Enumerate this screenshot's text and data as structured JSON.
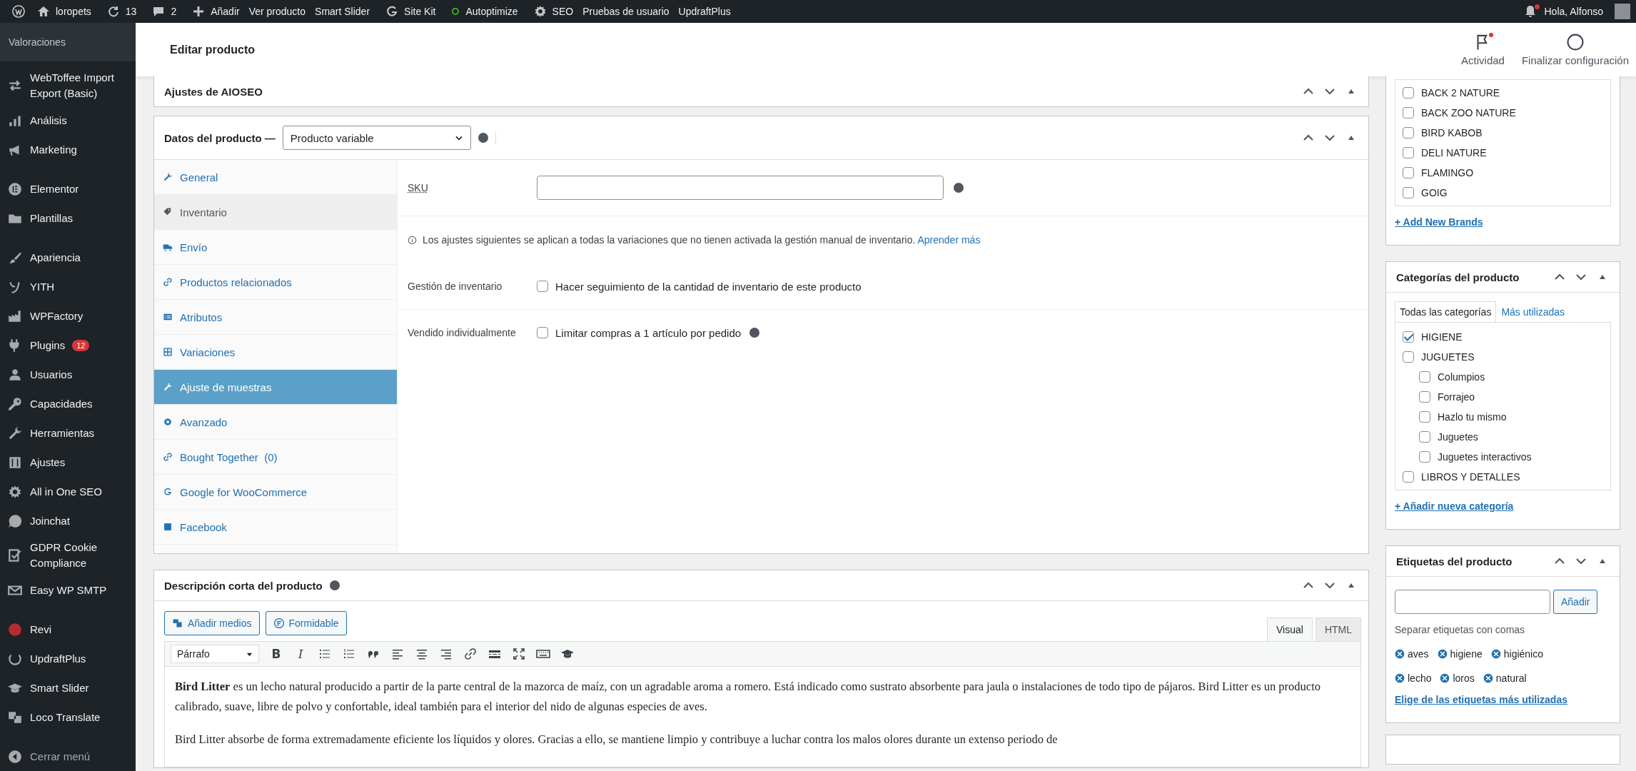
{
  "admin_bar": {
    "site": "loropets",
    "updates": "13",
    "comments": "2",
    "items": [
      "Añadir",
      "Ver producto",
      "Smart Slider",
      "Site Kit",
      "Autoptimize",
      "SEO",
      "Pruebas de usuario",
      "UpdraftPlus"
    ],
    "greeting": "Hola, Alfonso"
  },
  "sidebar": {
    "submenu_item": "Valoraciones",
    "groups": [
      [
        {
          "label": "WebToffee Import Export (Basic)"
        },
        {
          "label": "Análisis"
        },
        {
          "label": "Marketing"
        }
      ],
      [
        {
          "label": "Elementor"
        },
        {
          "label": "Plantillas"
        }
      ],
      [
        {
          "label": "Apariencia"
        },
        {
          "label": "YITH"
        },
        {
          "label": "WPFactory"
        },
        {
          "label": "Plugins",
          "badge": "12"
        },
        {
          "label": "Usuarios"
        },
        {
          "label": "Capacidades"
        },
        {
          "label": "Herramientas"
        },
        {
          "label": "Ajustes"
        },
        {
          "label": "All in One SEO"
        },
        {
          "label": "Joinchat"
        },
        {
          "label": "GDPR Cookie Compliance"
        },
        {
          "label": "Easy WP SMTP"
        }
      ],
      [
        {
          "label": "Revi"
        },
        {
          "label": "UpdraftPlus"
        },
        {
          "label": "Smart Slider"
        },
        {
          "label": "Loco Translate"
        }
      ]
    ],
    "collapse": "Cerrar menú"
  },
  "header": {
    "title": "Editar producto",
    "actions": [
      "Actividad",
      "Finalizar configuración"
    ]
  },
  "aioseo": {
    "title": "Ajustes de AIOSEO"
  },
  "product_data": {
    "title": "Datos del producto —",
    "type": "Producto variable",
    "tabs": [
      {
        "label": "General",
        "selected": false,
        "hovered": false
      },
      {
        "label": "Inventario",
        "selected": true,
        "hovered": false
      },
      {
        "label": "Envío",
        "selected": false,
        "hovered": false
      },
      {
        "label": "Productos relacionados",
        "selected": false,
        "hovered": false
      },
      {
        "label": "Atributos",
        "selected": false,
        "hovered": false
      },
      {
        "label": "Variaciones",
        "selected": false,
        "hovered": false
      },
      {
        "label": "Ajuste de muestras",
        "selected": false,
        "hovered": true
      },
      {
        "label": "Avanzado",
        "selected": false,
        "hovered": false
      },
      {
        "label": "Bought Together  (0)",
        "selected": false,
        "hovered": false
      },
      {
        "label": "Google for WooCommerce",
        "selected": false,
        "hovered": false
      },
      {
        "label": "Facebook",
        "selected": false,
        "hovered": false
      }
    ],
    "sku": {
      "label": "SKU"
    },
    "notice": {
      "text": "Los ajustes siguientes se aplican a todas la variaciones que no tienen activada la gestión manual de inventario.",
      "link": "Aprender más"
    },
    "options": [
      {
        "label": "Gestión de inventario",
        "text": "Hacer seguimiento de la cantidad de inventario de este producto",
        "checked": false,
        "help": false
      },
      {
        "label": "Vendido individualmente",
        "text": "Limitar compras a 1 artículo por pedido",
        "checked": false,
        "help": true
      }
    ]
  },
  "short_description": {
    "title": "Descripción corta del producto",
    "buttons": [
      "Añadir medios",
      "Formidable"
    ],
    "tabs": [
      {
        "label": "Visual",
        "selected": true
      },
      {
        "label": "HTML",
        "selected": false
      }
    ],
    "format": "Párrafo",
    "text_tools": [
      {
        "kind": "bold",
        "label": "B"
      },
      {
        "kind": "italic",
        "label": "I"
      }
    ],
    "paragraphs": [
      "**Bird Litter** es un lecho natural producido a partir de la parte central de la mazorca de maíz, con un agradable aroma a romero. Está indicado como sustrato absorbente para jaula o instalaciones de todo tipo de pájaros. Bird Litter es un producto calibrado, suave, libre de polvo y confortable, ideal también para el interior del nido de algunas especies de aves.",
      "Bird Litter absorbe de forma extremadamente eficiente los líquidos y olores. Gracias a ello, se mantiene limpio y contribuye a luchar contra los malos olores durante un extenso periodo de"
    ]
  },
  "brands": {
    "items": [
      {
        "label": "BACK 2 NATURE",
        "checked": false
      },
      {
        "label": "BACK ZOO NATURE",
        "checked": false
      },
      {
        "label": "BIRD KABOB",
        "checked": false
      },
      {
        "label": "DELI NATURE",
        "checked": false
      },
      {
        "label": "FLAMINGO",
        "checked": false
      },
      {
        "label": "GOIG",
        "checked": false
      }
    ],
    "link": "+ Add New Brands"
  },
  "categories": {
    "title": "Categorías del producto",
    "tabs": [
      {
        "label": "Todas las categorías",
        "selected": true
      },
      {
        "label": "Más utilizadas",
        "selected": false
      }
    ],
    "items": [
      {
        "label": "HIGIENE",
        "checked": true
      },
      {
        "label": "JUGUETES",
        "checked": false,
        "children": [
          {
            "label": "Columpios",
            "checked": false
          },
          {
            "label": "Forrajeo",
            "checked": false
          },
          {
            "label": "Hazlo tu mismo",
            "checked": false
          },
          {
            "label": "Juguetes",
            "checked": false
          },
          {
            "label": "Juguetes interactivos",
            "checked": false
          }
        ]
      },
      {
        "label": "LIBROS Y DETALLES",
        "checked": false
      }
    ],
    "link": "+ Añadir nueva categoría"
  },
  "tags": {
    "title": "Etiquetas del producto",
    "button": "Añadir",
    "hint": "Separar etiquetas con comas",
    "items": [
      "aves",
      "higiene",
      "higiénico",
      "lecho",
      "loros",
      "natural"
    ],
    "link": "Elige de las etiquetas más utilizadas"
  }
}
